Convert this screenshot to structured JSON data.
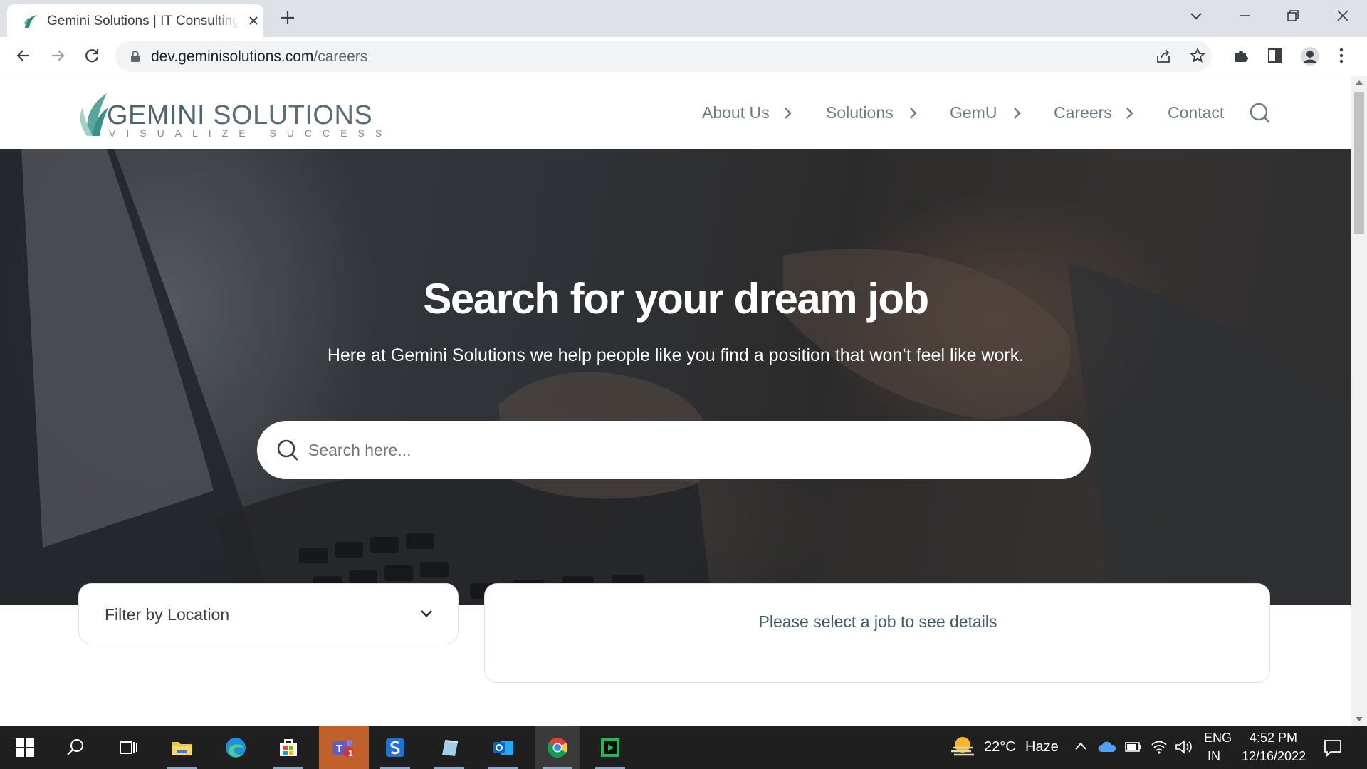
{
  "browser": {
    "tab_title": "Gemini Solutions | IT Consulting, Software Development",
    "url_host": "dev.geminisolutions.com",
    "url_path": "/careers"
  },
  "site": {
    "logo": {
      "brand_part1": "GEMINI",
      "brand_part2": " SOLUTIONS",
      "tagline": "VISUALIZE SUCCESS"
    },
    "nav": [
      "About Us",
      "Solutions",
      "GemU",
      "Careers",
      "Contact"
    ]
  },
  "hero": {
    "title": "Search for your dream job",
    "subtitle": "Here at Gemini Solutions we help people like you find a position that won’t feel like work.",
    "search_placeholder": "Search here...",
    "search_value": ""
  },
  "filters": {
    "location_label": "Filter by Location",
    "details_message": "Please select a job to see details"
  },
  "taskbar": {
    "apps": [
      "start",
      "search",
      "task-view",
      "file-explorer",
      "edge",
      "microsoft-store",
      "teams",
      "skype-app",
      "notepad-app",
      "outlook",
      "chrome",
      "media-app"
    ],
    "teams_badge": "1",
    "weather_temp": "22°C",
    "weather_text": "Haze",
    "lang_line1": "ENG",
    "lang_line2": "IN",
    "time": "4:52 PM",
    "date": "12/16/2022"
  },
  "colors": {
    "brand_teal": "#2f8a7e",
    "nav_text": "#6b7b84",
    "details_text": "#3d5a6c"
  }
}
